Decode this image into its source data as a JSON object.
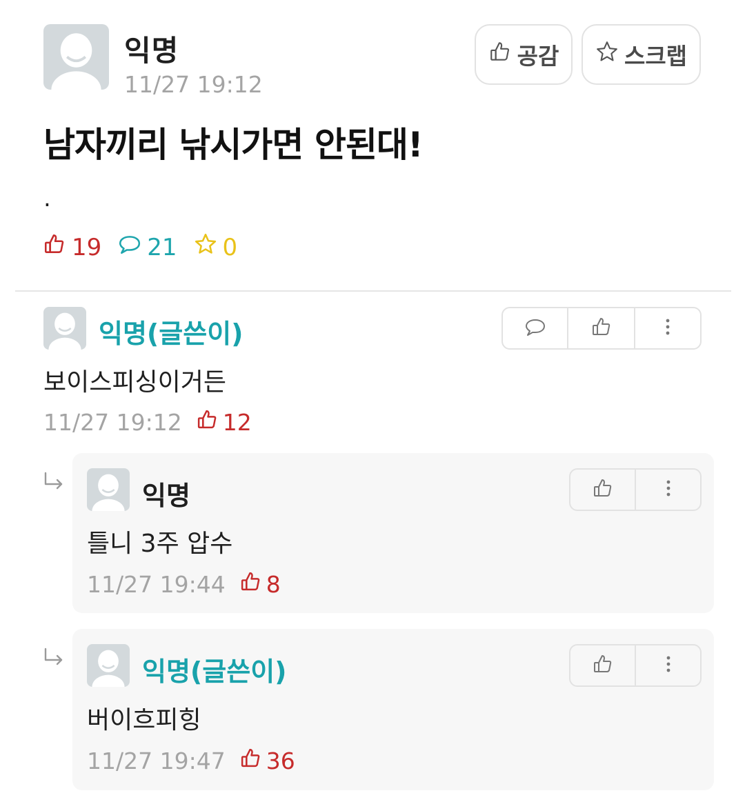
{
  "post": {
    "author": "익명",
    "time": "11/27 19:12",
    "title": "남자끼리 낚시가면 안된대!",
    "body": ".",
    "buttons": {
      "like_label": "공감",
      "scrap_label": "스크랩"
    },
    "stats": {
      "likes": "19",
      "comments": "21",
      "scraps": "0"
    }
  },
  "comments": [
    {
      "author": "익명(글쓴이)",
      "text": "보이스피싱이거든",
      "time": "11/27 19:12",
      "likes": "12"
    }
  ],
  "replies": [
    {
      "author": "익명",
      "text": "틀니 3주 압수",
      "time": "11/27 19:44",
      "likes": "8"
    },
    {
      "author": "익명(글쓴이)",
      "text": "버이흐피힝",
      "time": "11/27 19:47",
      "likes": "36"
    }
  ],
  "icons": {
    "thumbs_up": "thumbs-up-icon",
    "star": "star-icon",
    "comment": "comment-bubble-icon",
    "more": "more-vertical-icon",
    "reply_arrow": "reply-arrow-icon"
  },
  "colors": {
    "like": "#c62b2b",
    "comment": "#1ea5ad",
    "scrap": "#e9c219",
    "op_author": "#19a2ab",
    "meta": "#a4a4a4"
  }
}
